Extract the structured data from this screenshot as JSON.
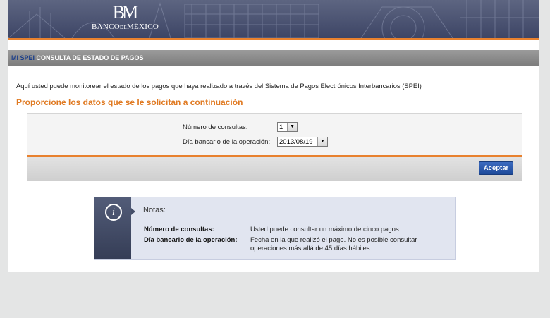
{
  "header": {
    "logo_mark": "BM",
    "logo_text_1": "BANCO",
    "logo_text_2": "DE",
    "logo_text_3": "MÉXICO"
  },
  "section_bar": {
    "brand": "MI SPEI",
    "title": "CONSULTA DE ESTADO DE PAGOS"
  },
  "intro_text": "Aquí usted puede monitorear el estado de los pagos que haya realizado a través del Sistema de Pagos Electrónicos Interbancarios (SPEI)",
  "form_heading": "Proporcione los datos que se le solicitan a continuación",
  "form": {
    "consultas_label": "Número de consultas:",
    "consultas_value": "1",
    "fecha_label": "Día bancario de la operación:",
    "fecha_value": "2013/08/19",
    "submit_label": "Aceptar"
  },
  "notes": {
    "icon": "info-icon",
    "title": "Notas:",
    "items": [
      {
        "label": "Número de consultas:",
        "desc": "Usted puede consultar un máximo de cinco pagos."
      },
      {
        "label": "Día bancario de la operación:",
        "desc": "Fecha en la que realizó el pago. No es posible consultar operaciones más allá de 45 días hábiles."
      }
    ]
  },
  "colors": {
    "accent_orange": "#e8812e",
    "banner_navy": "#4a5271",
    "button_blue": "#1e4a9a",
    "notes_bg": "#e1e5f0"
  }
}
